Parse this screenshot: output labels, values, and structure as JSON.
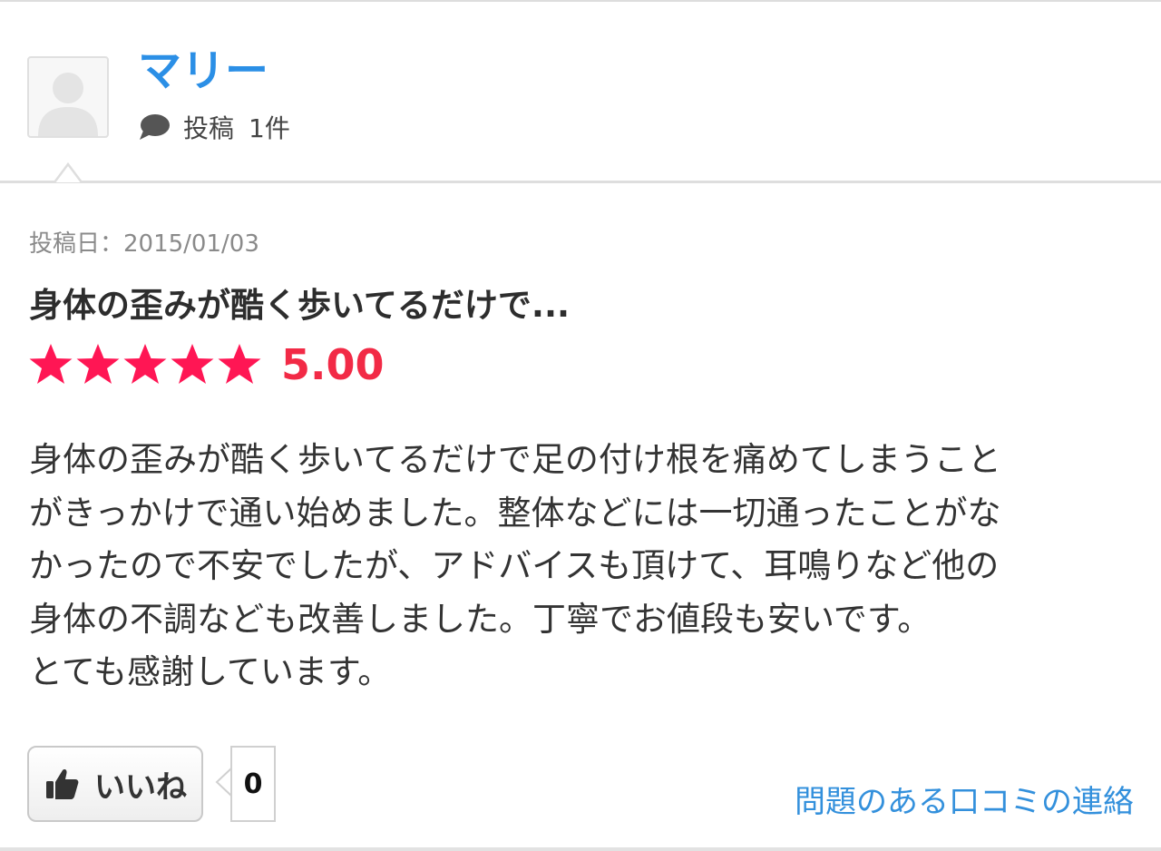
{
  "reviewer": {
    "name": "マリー",
    "post_label": "投稿",
    "post_count": "1件"
  },
  "review": {
    "date": "投稿日：2015/01/03",
    "title": "身体の歪みが酷く歩いてるだけで...",
    "rating": 5.0,
    "rating_text": "5.00",
    "body_lines": [
      "身体の歪みが酷く歩いてるだけで足の付け根を痛めてしまうこと",
      "がきっかけで通い始めました。整体などには一切通ったことがな",
      "かったので不安でしたが、アドバイスも頂けて、耳鳴りなど他の",
      "身体の不調なども改善しました。丁寧でお値段も安いです。",
      "とても感謝しています。"
    ]
  },
  "actions": {
    "like_label": "いいね",
    "like_count": "0",
    "report_label": "問題のある口コミの連絡"
  },
  "icons": {
    "avatar": "user-silhouette",
    "post": "speech-bubble-icon",
    "like": "thumbs-up-icon",
    "rating": "star-icon"
  },
  "colors": {
    "name": "#2b8fe6",
    "star": "#ff1654",
    "score": "#f22a46",
    "link": "#3390dc"
  }
}
